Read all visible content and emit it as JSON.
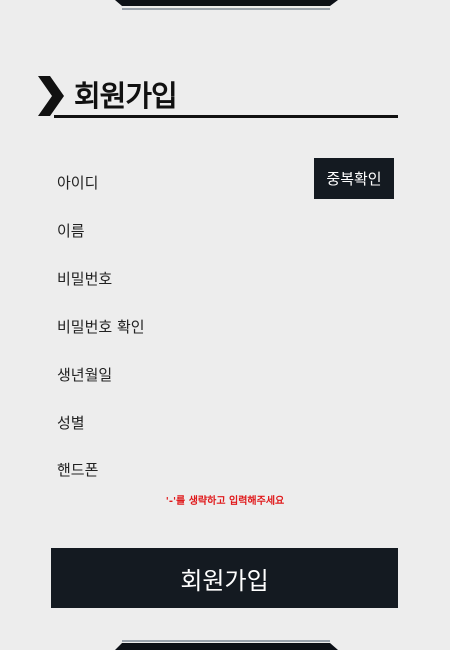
{
  "header": {
    "title": "회원가입"
  },
  "form": {
    "fields": [
      {
        "label": "아이디"
      },
      {
        "label": "이름"
      },
      {
        "label": "비밀번호"
      },
      {
        "label": "비밀번호 확인"
      },
      {
        "label": "생년월일"
      },
      {
        "label": "성별"
      },
      {
        "label": "핸드폰"
      }
    ],
    "duplicate_check_label": "중복확인",
    "phone_hint": "'-'를 생략하고 입력해주세요",
    "submit_label": "회원가입"
  },
  "colors": {
    "accent": "#141a21",
    "hint": "#e0191b",
    "panel": "#ededed"
  }
}
